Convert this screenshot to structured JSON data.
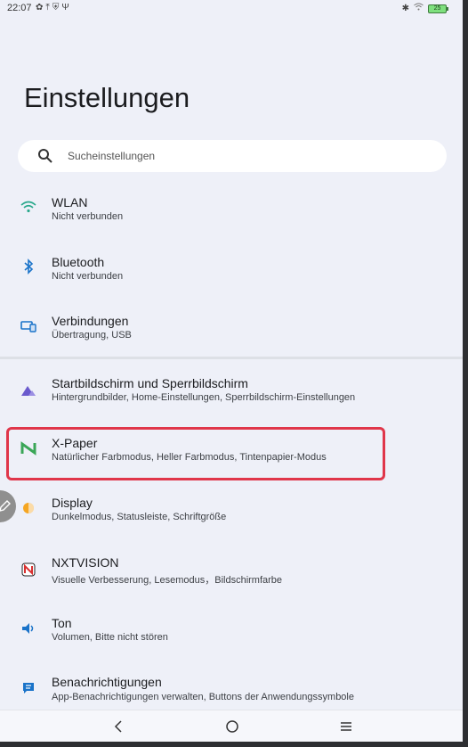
{
  "status_bar": {
    "time": "22:07",
    "battery_level": "25"
  },
  "page": {
    "title": "Einstellungen"
  },
  "search": {
    "placeholder": "Sucheinstellungen"
  },
  "items": [
    {
      "title": "WLAN",
      "subtitle": "Nicht verbunden",
      "icon": "wifi-icon"
    },
    {
      "title": "Bluetooth",
      "subtitle": "Nicht verbunden",
      "icon": "bluetooth-icon"
    },
    {
      "title": "Verbindungen",
      "subtitle": "Übertragung, USB",
      "icon": "connections-icon"
    },
    {
      "title": "Startbildschirm und Sperrbildschirm",
      "subtitle": "Hintergrundbilder, Home-Einstellungen, Sperrbildschirm-Einstellungen",
      "icon": "home-screen-icon"
    },
    {
      "title": "X-Paper",
      "subtitle": "Natürlicher Farbmodus, Heller Farbmodus, Tintenpapier-Modus",
      "icon": "x-paper-icon"
    },
    {
      "title": "Display",
      "subtitle": "Dunkelmodus, Statusleiste, Schriftgröße",
      "icon": "display-icon"
    },
    {
      "title": "NXTVISION",
      "subtitle": "Visuelle Verbesserung, Lesemodus，Bildschirmfarbe",
      "icon": "nxtvision-icon"
    },
    {
      "title": "Ton",
      "subtitle": "Volumen, Bitte nicht stören",
      "icon": "sound-icon"
    },
    {
      "title": "Benachrichtigungen",
      "subtitle": "App-Benachrichtigungen verwalten, Buttons der Anwendungssymbole",
      "icon": "notifications-icon"
    }
  ],
  "colors": {
    "background": "#eef0f8",
    "highlight": "#e0364a",
    "accent_blue": "#1a73c9"
  }
}
